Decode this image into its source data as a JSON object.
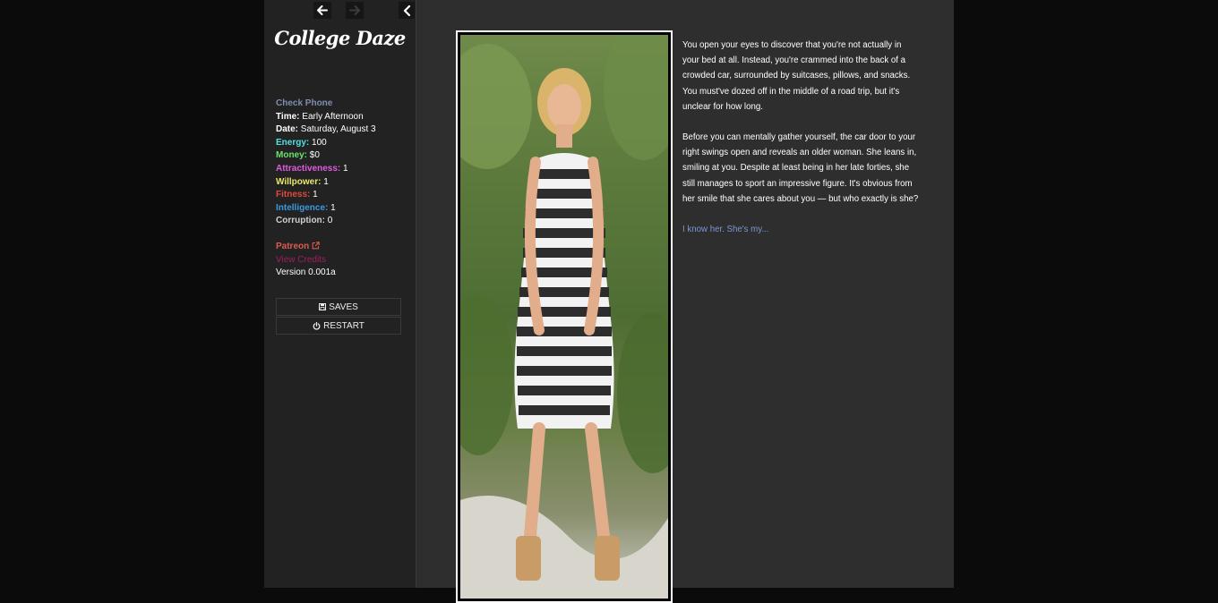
{
  "sidebar": {
    "title": "College Daze",
    "check_phone": "Check Phone",
    "stats": [
      {
        "label": "Time:",
        "value": "Early Afternoon",
        "color": "#ffffff"
      },
      {
        "label": "Date:",
        "value": "Saturday, August 3",
        "color": "#ffffff"
      },
      {
        "label": "Energy:",
        "value": "100",
        "color": "#55e0e0"
      },
      {
        "label": "Money:",
        "value": "$0",
        "color": "#6ce26c"
      },
      {
        "label": "Attractiveness:",
        "value": "1",
        "color": "#e05ae0"
      },
      {
        "label": "Willpower:",
        "value": "1",
        "color": "#e8e86a"
      },
      {
        "label": "Fitness:",
        "value": "1",
        "color": "#e04a3a"
      },
      {
        "label": "Intelligence:",
        "value": "1",
        "color": "#3a9ae0"
      },
      {
        "label": "Corruption:",
        "value": "0",
        "color": "#cfcfcf"
      }
    ],
    "patreon": "Patreon",
    "credits": "View Credits",
    "version": "Version 0.001a",
    "saves_label": "SAVES",
    "restart_label": "RESTART"
  },
  "story": {
    "paragraphs": [
      "You open your eyes to discover that you're not actually in your bed at all. Instead, you're crammed into the back of a crowded car, surrounded by suitcases, pillows, and snacks. You must've dozed off in the middle of a road trip, but it's unclear for how long.",
      "Before you can mentally gather yourself, the car door to your right swings open and reveals an older woman. She leans in, smiling at you. Despite at least being in her late forties, she still manages to sport an impressive figure. It's obvious from her smile that she cares about you — but who exactly is she?"
    ],
    "choice": "I know her. She's my..."
  },
  "icons": {
    "back": "arrow-left-icon",
    "forward": "arrow-right-icon",
    "collapse": "chevron-left-icon",
    "saves": "floppy-disk-icon",
    "restart": "power-icon",
    "patreon": "external-link-icon"
  }
}
